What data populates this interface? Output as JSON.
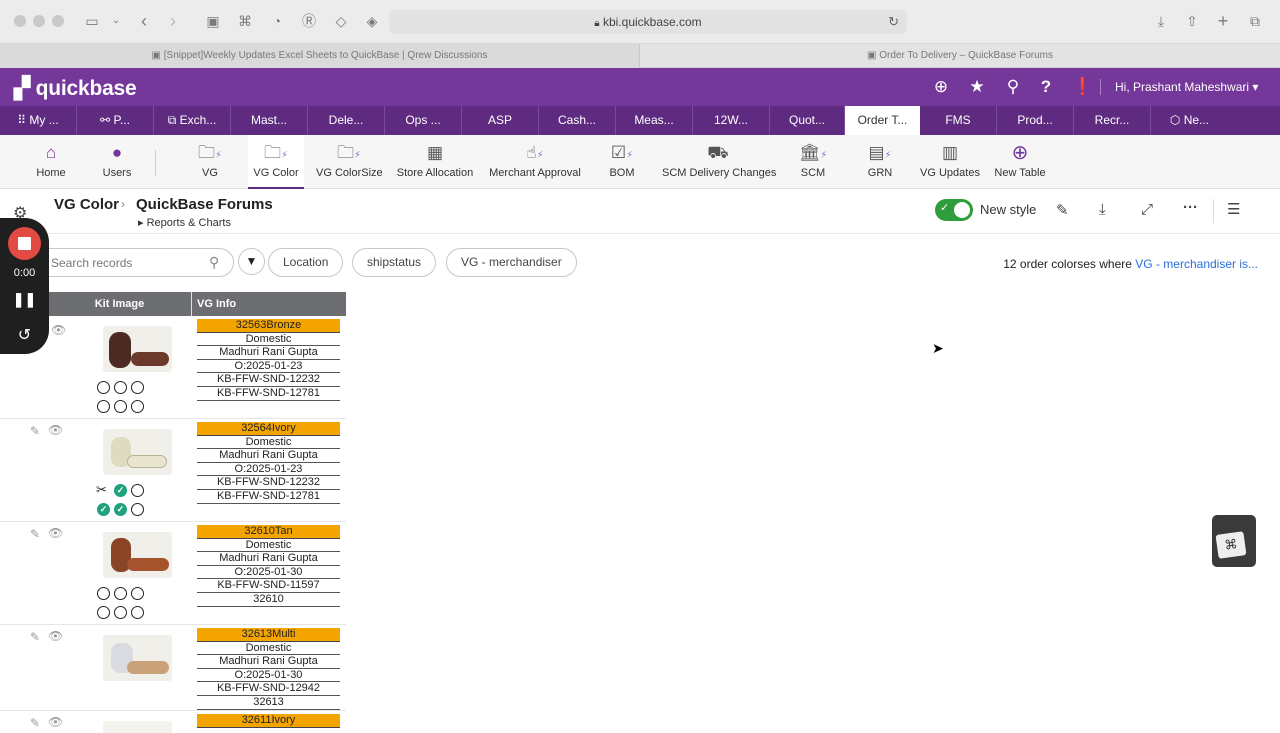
{
  "browser": {
    "url": "kbi.quickbase.com",
    "tabs": [
      {
        "label": "[Snippet]Weekly Updates Excel Sheets to QuickBase | Qrew Discussions"
      },
      {
        "label": "Order To Delivery – QuickBase Forums"
      }
    ]
  },
  "header": {
    "logo": "quickbase",
    "user": "Hi, Prashant Maheshwari",
    "brand_color": "#74379a"
  },
  "app_tabs": [
    {
      "label": "My ..."
    },
    {
      "label": "P..."
    },
    {
      "label": "Exch..."
    },
    {
      "label": "Mast..."
    },
    {
      "label": "Dele..."
    },
    {
      "label": "Ops ..."
    },
    {
      "label": "ASP"
    },
    {
      "label": "Cash..."
    },
    {
      "label": "Meas..."
    },
    {
      "label": "12W..."
    },
    {
      "label": "Quot..."
    },
    {
      "label": "Order T..."
    },
    {
      "label": "FMS"
    },
    {
      "label": "Prod..."
    },
    {
      "label": "Recr..."
    },
    {
      "label": "Ne..."
    }
  ],
  "table_bar": [
    {
      "label": "Home",
      "icon": "home-icon"
    },
    {
      "label": "Users",
      "icon": "user-icon"
    },
    {
      "label": "VG",
      "icon": "folder-icon"
    },
    {
      "label": "VG Color",
      "icon": "folder-icon"
    },
    {
      "label": "VG ColorSize",
      "icon": "folder-icon"
    },
    {
      "label": "Store Allocation",
      "icon": "store-icon"
    },
    {
      "label": "Merchant Approval",
      "icon": "hand-icon"
    },
    {
      "label": "BOM",
      "icon": "checklist-icon"
    },
    {
      "label": "SCM Delivery Changes",
      "icon": "forklift-icon"
    },
    {
      "label": "SCM",
      "icon": "building-icon"
    },
    {
      "label": "GRN",
      "icon": "receipt-icon"
    },
    {
      "label": "VG Updates",
      "icon": "calendar-icon"
    },
    {
      "label": "New Table",
      "icon": "plus-circle-icon"
    }
  ],
  "page": {
    "table_name": "VG Color",
    "report_name": "QuickBase Forums",
    "breadcrumb": "Reports & Charts",
    "new_style_label": "New style",
    "new_style_on": true
  },
  "filters": {
    "search_placeholder": "Search records",
    "pills": [
      {
        "label": "Location"
      },
      {
        "label": "shipstatus"
      },
      {
        "label": "VG - merchandiser"
      }
    ],
    "summary_text": "12 order colorses where",
    "summary_link": "VG - merchandiser is..."
  },
  "grid": {
    "columns": [
      {
        "label": "Kit Image"
      },
      {
        "label": "VG Info"
      }
    ],
    "rows": [
      {
        "info": [
          "32563Bronze",
          "Domestic",
          "Madhuri Rani Gupta",
          "O:2025-01-23",
          "KB-FFW-SND-12232",
          "KB-FFW-SND-12781"
        ],
        "status": [
          "empty",
          "empty",
          "empty",
          "empty",
          "empty",
          "empty"
        ],
        "shoe_color": "#6b3a2a"
      },
      {
        "info": [
          "32564Ivory",
          "Domestic",
          "Madhuri Rani Gupta",
          "O:2025-01-23",
          "KB-FFW-SND-12232",
          "KB-FFW-SND-12781"
        ],
        "status": [
          "scissors",
          "ok",
          "empty",
          "ok",
          "ok",
          "empty"
        ],
        "shoe_color": "#e9e6cf"
      },
      {
        "info": [
          "32610Tan",
          "Domestic",
          "Madhuri Rani Gupta",
          "O:2025-01-30",
          "KB-FFW-SND-11597",
          "32610"
        ],
        "status": [
          "empty",
          "empty",
          "empty",
          "empty",
          "empty",
          "empty"
        ],
        "shoe_color": "#a5532c"
      },
      {
        "info": [
          "32613Multi",
          "Domestic",
          "Madhuri Rani Gupta",
          "O:2025-01-30",
          "KB-FFW-SND-12942",
          "32613"
        ],
        "status": [],
        "shoe_color": "#c9a27a"
      },
      {
        "info": [
          "32611Ivory"
        ],
        "status": [],
        "shoe_color": "#e9e6cf"
      }
    ]
  },
  "recorder": {
    "time": "0:00"
  },
  "colors": {
    "accent": "#74379a",
    "tab_bar": "#5e2b80",
    "header_cell": "#f3a400",
    "toggle": "#2e9d3c",
    "ok": "#1ea37e"
  }
}
